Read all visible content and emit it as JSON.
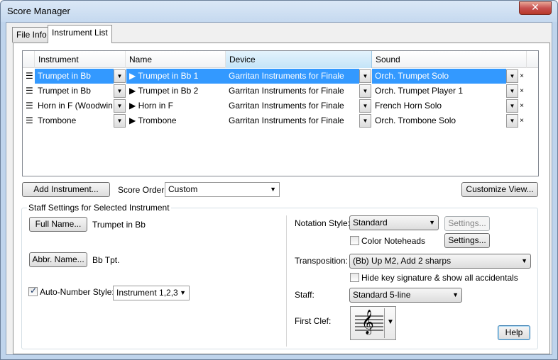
{
  "window": {
    "title": "Score Manager",
    "close_glyph": "✕"
  },
  "tabs": [
    {
      "label": "File Info",
      "active": false
    },
    {
      "label": "Instrument List",
      "active": true
    }
  ],
  "grid": {
    "columns": [
      "Instrument",
      "Name",
      "Device",
      "Sound"
    ],
    "rows": [
      {
        "instrument": "Trumpet in Bb",
        "name": "▶ Trumpet in Bb 1",
        "device": "Garritan Instruments for Finale",
        "sound": "Orch. Trumpet Solo",
        "selected": true
      },
      {
        "instrument": "Trumpet in Bb",
        "name": "▶ Trumpet in Bb 2",
        "device": "Garritan Instruments for Finale",
        "sound": "Orch. Trumpet Player 1",
        "selected": false
      },
      {
        "instrument": "Horn in F (Woodwin...",
        "name": "▶ Horn in F",
        "device": "Garritan Instruments for Finale",
        "sound": "French Horn Solo",
        "selected": false
      },
      {
        "instrument": "Trombone",
        "name": "▶ Trombone",
        "device": "Garritan Instruments for Finale",
        "sound": "Orch. Trombone Solo",
        "selected": false
      }
    ],
    "row_handle_glyph": "☰",
    "remove_glyph": "×",
    "dropdown_glyph": "▼"
  },
  "toolbar": {
    "add_instrument": "Add Instrument...",
    "score_order_label": "Score Order:",
    "score_order_value": "Custom",
    "customize_view": "Customize View..."
  },
  "staff_settings": {
    "legend": "Staff Settings for Selected Instrument",
    "full_name_button": "Full Name...",
    "full_name_value": "Trumpet in Bb",
    "abbr_name_button": "Abbr. Name...",
    "abbr_name_value": "Bb Tpt.",
    "auto_number_label": "Auto-Number Style:",
    "auto_number_checked": true,
    "auto_number_value": "Instrument 1,2,3",
    "notation_style_label": "Notation Style:",
    "notation_style_value": "Standard",
    "settings_disabled": "Settings...",
    "color_noteheads_label": "Color Noteheads",
    "color_noteheads_checked": false,
    "settings_enabled": "Settings...",
    "transposition_label": "Transposition:",
    "transposition_value": "(Bb) Up M2, Add 2 sharps",
    "hide_key_label": "Hide key signature & show all accidentals",
    "hide_key_checked": false,
    "staff_label": "Staff:",
    "staff_value": "Standard 5-line",
    "first_clef_label": "First Clef:",
    "clef_glyph": "𝄞",
    "help_button": "Help"
  }
}
